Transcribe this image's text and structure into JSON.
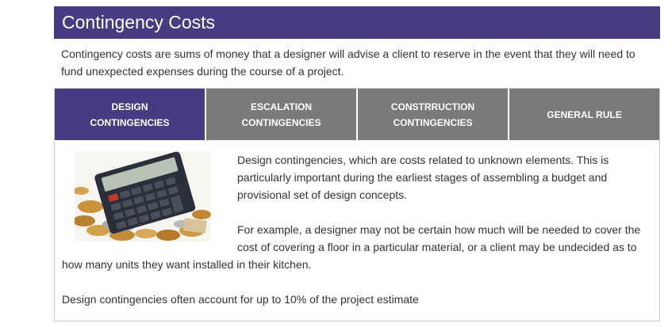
{
  "header": {
    "title": "Contingency Costs"
  },
  "intro": "Contingency costs are sums of money that a designer will advise a client to reserve in the event that they will need to fund unexpected expenses during the course of a project.",
  "tabs": [
    {
      "line1": "DESIGN",
      "line2": "CONTINGENCIES",
      "active": true
    },
    {
      "line1": "ESCALATION",
      "line2": "CONTINGENCIES",
      "active": false
    },
    {
      "line1": "CONSTRRUCTION",
      "line2": "CONTINGENCIES",
      "active": false
    },
    {
      "line1": "GENERAL RULE",
      "line2": "",
      "active": false
    }
  ],
  "panel": {
    "image_icon": "calculator-coins-image",
    "paragraphs": [
      "Design contingencies, which are costs related to unknown elements. This is particularly important during the earliest stages of assembling a budget and provisional set of design concepts.",
      "For example, a designer may not be certain how much will be needed to cover the cost of covering a floor in a particular material, or a client may be undecided as to how many units they want installed in their kitchen.",
      "Design contingencies often account for up to 10% of the project estimate"
    ]
  },
  "colors": {
    "accent": "#453c82",
    "tab_inactive": "#7a7a7a",
    "text": "#333333"
  }
}
